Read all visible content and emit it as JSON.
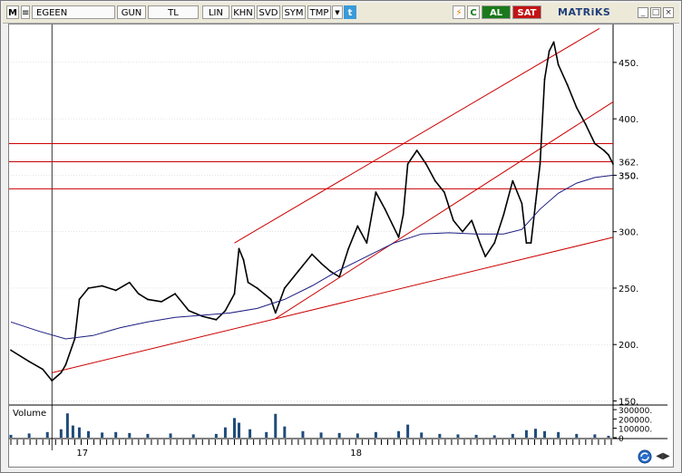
{
  "toolbar": {
    "m_label": "M",
    "symbol": "EGEEN",
    "period": "GUN",
    "currency": "TL",
    "scale": "LIN",
    "btn_khn": "KHN",
    "btn_svd": "SVD",
    "btn_sym": "SYM",
    "btn_tmp": "TMP",
    "icon_twitter": "twitter-icon",
    "icon_flash": "lightning-icon",
    "icon_refresh": "refresh-icon",
    "buy_label": "AL",
    "sell_label": "SAT",
    "brand": "MATRiKS",
    "colors": {
      "buy": "#1a7a1a",
      "sell": "#c31414",
      "brand": "#1f3f7a"
    }
  },
  "chart_data": {
    "type": "line",
    "y_axis": {
      "ticks": [
        150,
        200,
        250,
        300,
        350,
        400,
        450
      ],
      "ylim": [
        148,
        482
      ],
      "position": "right"
    },
    "x_axis": {
      "labels": [
        "17",
        "18"
      ],
      "span_days": [
        0,
        660
      ],
      "label_positions_days": [
        70,
        370
      ]
    },
    "price_tags": [
      "362.",
      "350."
    ],
    "price_tag_values": [
      362,
      350
    ],
    "series": [
      {
        "kind": "price",
        "points": [
          [
            0,
            195
          ],
          [
            20,
            185
          ],
          [
            35,
            178
          ],
          [
            45,
            168
          ],
          [
            55,
            175
          ],
          [
            60,
            182
          ],
          [
            70,
            205
          ],
          [
            75,
            240
          ],
          [
            85,
            250
          ],
          [
            100,
            252
          ],
          [
            115,
            248
          ],
          [
            130,
            255
          ],
          [
            140,
            245
          ],
          [
            150,
            240
          ],
          [
            165,
            238
          ],
          [
            180,
            245
          ],
          [
            195,
            230
          ],
          [
            210,
            225
          ],
          [
            225,
            222
          ],
          [
            235,
            230
          ],
          [
            245,
            245
          ],
          [
            250,
            285
          ],
          [
            255,
            275
          ],
          [
            260,
            255
          ],
          [
            270,
            250
          ],
          [
            285,
            240
          ],
          [
            290,
            228
          ],
          [
            300,
            250
          ],
          [
            315,
            265
          ],
          [
            330,
            280
          ],
          [
            340,
            272
          ],
          [
            350,
            265
          ],
          [
            360,
            260
          ],
          [
            370,
            285
          ],
          [
            380,
            305
          ],
          [
            390,
            290
          ],
          [
            400,
            335
          ],
          [
            410,
            320
          ],
          [
            425,
            295
          ],
          [
            430,
            315
          ],
          [
            435,
            360
          ],
          [
            445,
            372
          ],
          [
            455,
            360
          ],
          [
            465,
            345
          ],
          [
            475,
            335
          ],
          [
            485,
            310
          ],
          [
            495,
            300
          ],
          [
            505,
            310
          ],
          [
            515,
            288
          ],
          [
            520,
            278
          ],
          [
            530,
            290
          ],
          [
            540,
            315
          ],
          [
            550,
            345
          ],
          [
            560,
            325
          ],
          [
            565,
            290
          ],
          [
            570,
            290
          ],
          [
            575,
            325
          ],
          [
            580,
            360
          ],
          [
            585,
            435
          ],
          [
            590,
            460
          ],
          [
            595,
            468
          ],
          [
            600,
            448
          ],
          [
            610,
            430
          ],
          [
            620,
            410
          ],
          [
            630,
            395
          ],
          [
            640,
            378
          ],
          [
            650,
            372
          ],
          [
            655,
            368
          ],
          [
            660,
            360
          ]
        ]
      },
      {
        "kind": "moving-average",
        "points": [
          [
            0,
            220
          ],
          [
            30,
            212
          ],
          [
            60,
            205
          ],
          [
            90,
            208
          ],
          [
            120,
            215
          ],
          [
            150,
            220
          ],
          [
            180,
            224
          ],
          [
            210,
            226
          ],
          [
            240,
            228
          ],
          [
            270,
            232
          ],
          [
            300,
            240
          ],
          [
            330,
            252
          ],
          [
            360,
            266
          ],
          [
            390,
            278
          ],
          [
            420,
            290
          ],
          [
            450,
            298
          ],
          [
            480,
            299
          ],
          [
            510,
            298
          ],
          [
            540,
            298
          ],
          [
            560,
            302
          ],
          [
            580,
            320
          ],
          [
            600,
            334
          ],
          [
            620,
            343
          ],
          [
            640,
            348
          ],
          [
            660,
            350
          ]
        ]
      }
    ],
    "trendlines": [
      {
        "from": [
          45,
          175
        ],
        "to": [
          660,
          295
        ]
      },
      {
        "from": [
          245,
          290
        ],
        "to": [
          645,
          480
        ]
      },
      {
        "from": [
          290,
          223
        ],
        "to": [
          660,
          415
        ]
      }
    ],
    "horizontal_levels": [
      378,
      362,
      338
    ],
    "volume": {
      "label": "Volume",
      "ticks": [
        "300000.",
        "200000.",
        "100000.",
        "0"
      ],
      "tick_values": [
        300000,
        200000,
        100000,
        0
      ],
      "ylim": [
        0,
        330000
      ],
      "bars": [
        [
          0,
          30000
        ],
        [
          20,
          45000
        ],
        [
          40,
          60000
        ],
        [
          55,
          90000
        ],
        [
          62,
          260000
        ],
        [
          68,
          130000
        ],
        [
          75,
          110000
        ],
        [
          85,
          70000
        ],
        [
          100,
          55000
        ],
        [
          115,
          60000
        ],
        [
          130,
          50000
        ],
        [
          150,
          40000
        ],
        [
          175,
          45000
        ],
        [
          200,
          35000
        ],
        [
          225,
          40000
        ],
        [
          235,
          110000
        ],
        [
          245,
          210000
        ],
        [
          250,
          160000
        ],
        [
          262,
          90000
        ],
        [
          280,
          60000
        ],
        [
          290,
          255000
        ],
        [
          300,
          120000
        ],
        [
          320,
          70000
        ],
        [
          340,
          55000
        ],
        [
          360,
          50000
        ],
        [
          380,
          45000
        ],
        [
          400,
          60000
        ],
        [
          425,
          70000
        ],
        [
          435,
          140000
        ],
        [
          450,
          55000
        ],
        [
          470,
          40000
        ],
        [
          490,
          35000
        ],
        [
          510,
          30000
        ],
        [
          530,
          25000
        ],
        [
          550,
          40000
        ],
        [
          565,
          80000
        ],
        [
          575,
          95000
        ],
        [
          585,
          70000
        ],
        [
          600,
          60000
        ],
        [
          620,
          40000
        ],
        [
          640,
          35000
        ],
        [
          655,
          20000
        ]
      ]
    },
    "colors": {
      "price": "#000000",
      "moving_average": "#1c1c80",
      "trendline": "#cc0000",
      "level": "#cc0000",
      "volume": "#1f4b7a",
      "grid": "#c8c8d8"
    }
  }
}
